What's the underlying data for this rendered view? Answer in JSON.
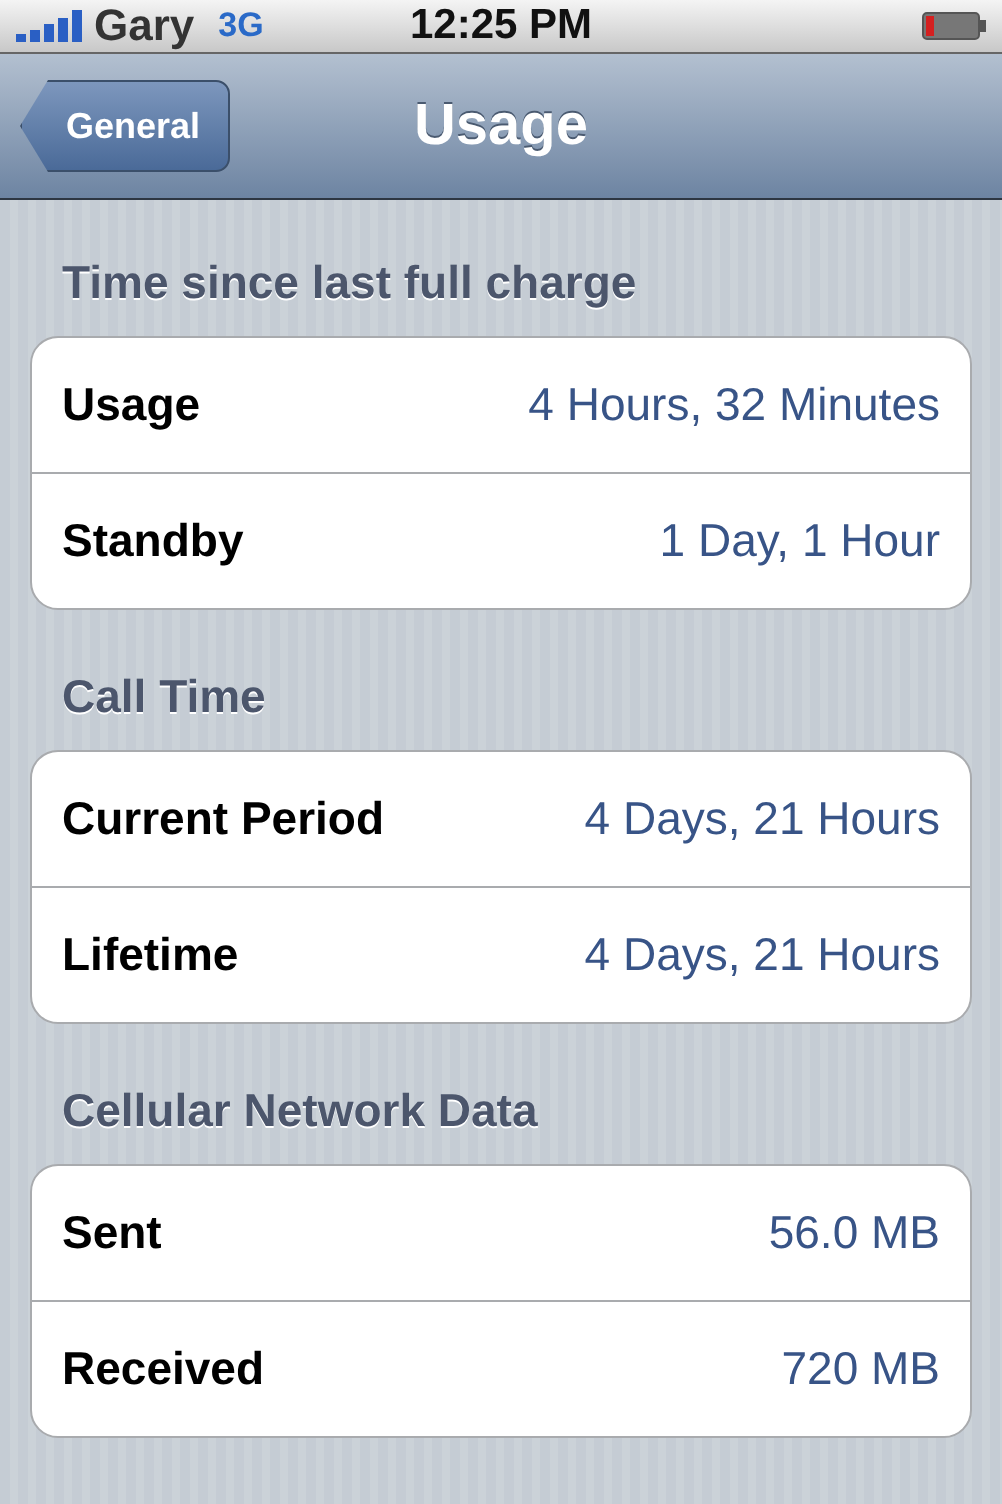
{
  "status_bar": {
    "carrier": "Gary",
    "network": "3G",
    "time": "12:25 PM"
  },
  "nav_bar": {
    "back_button": "General",
    "title": "Usage"
  },
  "sections": [
    {
      "header": "Time since last full charge",
      "rows": [
        {
          "label": "Usage",
          "value": "4 Hours, 32 Minutes"
        },
        {
          "label": "Standby",
          "value": "1 Day, 1 Hour"
        }
      ]
    },
    {
      "header": "Call Time",
      "rows": [
        {
          "label": "Current Period",
          "value": "4 Days, 21 Hours"
        },
        {
          "label": "Lifetime",
          "value": "4 Days, 21 Hours"
        }
      ]
    },
    {
      "header": "Cellular Network Data",
      "rows": [
        {
          "label": "Sent",
          "value": "56.0 MB"
        },
        {
          "label": "Received",
          "value": "720 MB"
        }
      ]
    }
  ]
}
